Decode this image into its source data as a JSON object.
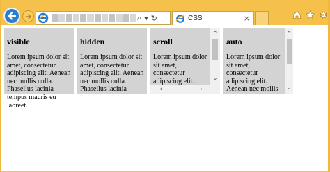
{
  "browser": {
    "tab_title": "CSS",
    "tab_close": "×",
    "address_tools": {
      "search": "⌕",
      "dropdown": "▾",
      "refresh": "↻"
    }
  },
  "boxes": [
    {
      "heading": "visible",
      "text": "Lorem ipsum dolor sit amet, consectetur adipiscing elit. Aenean nec mollis nulla. Phasellus lacinia tempus mauris eu laoreet."
    },
    {
      "heading": "hidden",
      "text": "Lorem ipsum dolor sit amet, consectetur adipiscing elit. Aenean nec mollis nulla. Phasellus lacinia tempus mauris eu laoreet."
    },
    {
      "heading": "scroll",
      "text": "Lorem ipsum dolor sit amet, consectetur adipiscing elit. Aenean nec mollis nulla. Phasellus lacinia tempus mauris eu laoreet."
    },
    {
      "heading": "auto",
      "text": "Lorem ipsum dolor sit amet, consectetur adipiscing elit. Aenean nec mollis nulla. Phasellus lacinia tempus mauris eu laoreet."
    }
  ],
  "colors": {
    "window_frame": "#f5c14a",
    "box_background": "#d3d3d3",
    "back_button": "#2a7fd0"
  },
  "icons": [
    "back-arrow-icon",
    "forward-arrow-icon",
    "ie-logo-icon",
    "home-icon",
    "star-icon",
    "gear-icon"
  ]
}
